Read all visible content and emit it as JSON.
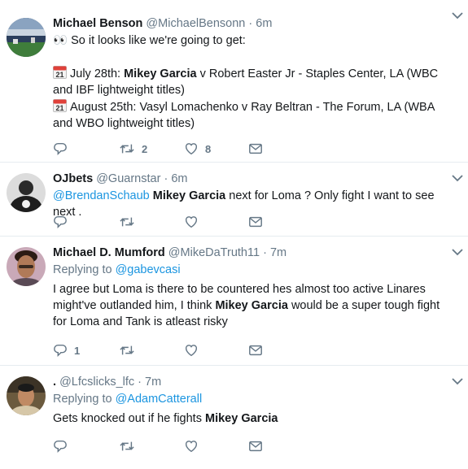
{
  "tweets": [
    {
      "name": "Michael Benson",
      "handle": "@MichaelBensonn",
      "dot": "·",
      "time": "6m",
      "eyes": "👀",
      "line1": "So it looks like we're going to get:",
      "cal_day": "21",
      "event1_pre": "July 28th: ",
      "event1_bold": "Mikey Garcia",
      "event1_post": " v Robert Easter Jr - Staples Center, LA (WBC and IBF lightweight titles)",
      "event2": "August 25th: Vasyl Lomachenko v Ray Beltran - The Forum, LA (WBA and WBO lightweight titles)",
      "retweets": "2",
      "likes": "8"
    },
    {
      "name": "OJbets",
      "handle": "@Guarnstar",
      "dot": "·",
      "time": "6m",
      "mention": "@BrendanSchaub",
      "bold": "Mikey Garcia",
      "rest": " next for Loma ? Only fight I want to see next ."
    },
    {
      "name": "Michael D. Mumford",
      "handle": "@MikeDaTruth11",
      "dot": "·",
      "time": "7m",
      "replying_label": "Replying to ",
      "replying_to": "@gabevcasi",
      "pre": "I agree but Loma is there to be countered hes almost too active  Linares might've outlanded him, I think ",
      "bold": "Mikey Garcia",
      "post": " would be a super  tough fight for Loma and Tank is atleast risky",
      "replies": "1"
    },
    {
      "name": ".",
      "handle": "@Lfcslicks_lfc",
      "dot": "·",
      "time": "7m",
      "replying_label": "Replying to ",
      "replying_to": "@AdamCatterall",
      "pre": "Gets knocked out if he fights ",
      "bold": "Mikey Garcia"
    }
  ],
  "colors": {
    "text": "#14171a",
    "secondary": "#657786",
    "link": "#1b95e0",
    "divider": "#e6ecf0"
  },
  "icons": [
    "reply-icon",
    "retweet-icon",
    "like-icon",
    "direct-message-icon",
    "chevron-down-icon",
    "calendar-icon",
    "eyes-emoji"
  ]
}
